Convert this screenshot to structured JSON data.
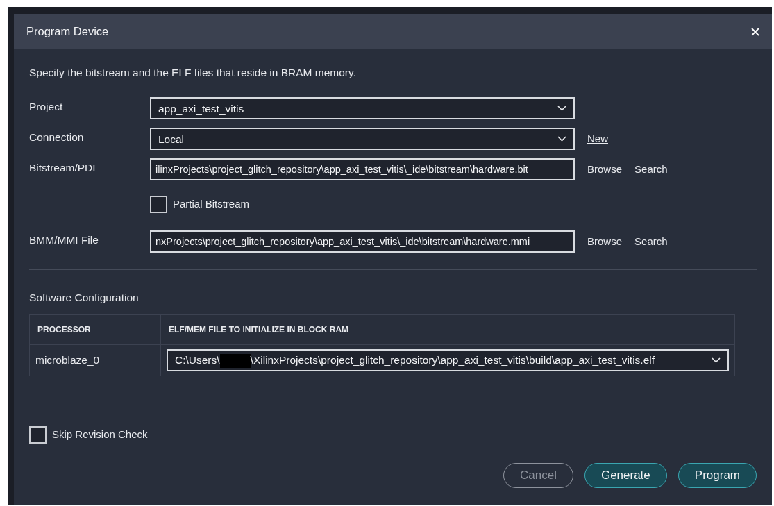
{
  "window": {
    "title": "Program Device"
  },
  "description": "Specify the bitstream and the ELF files that reside in BRAM memory.",
  "fields": [
    {
      "kind": "select",
      "label": "Project",
      "value": "app_axi_test_vitis"
    },
    {
      "kind": "select",
      "label": "Connection",
      "value": "Local",
      "links": [
        "New"
      ]
    },
    {
      "kind": "text",
      "label": "Bitstream/PDI",
      "value": "ilinxProjects\\project_glitch_repository\\app_axi_test_vitis\\_ide\\bitstream\\hardware.bit",
      "links": [
        "Browse",
        "Search"
      ]
    },
    {
      "kind": "checkbox",
      "label": "Partial Bitstream",
      "checked": false
    },
    {
      "kind": "text",
      "label": "BMM/MMI File",
      "value": "nxProjects\\project_glitch_repository\\app_axi_test_vitis\\_ide\\bitstream\\hardware.mmi",
      "links": [
        "Browse",
        "Search"
      ]
    }
  ],
  "software_configuration": {
    "title": "Software Configuration",
    "columns": [
      "PROCESSOR",
      "ELF/MEM FILE TO INITIALIZE IN BLOCK RAM"
    ],
    "rows": [
      {
        "processor": "microblaze_0",
        "file_before": "C:\\Users\\",
        "redacted": true,
        "file_after": "\\XilinxProjects\\project_glitch_repository\\app_axi_test_vitis\\build\\app_axi_test_vitis.elf"
      }
    ]
  },
  "skip_revision_check": {
    "label": "Skip Revision Check",
    "checked": false
  },
  "buttons": [
    {
      "label": "Cancel",
      "disabled": true
    },
    {
      "label": "Generate",
      "disabled": false
    },
    {
      "label": "Program",
      "disabled": false
    }
  ]
}
